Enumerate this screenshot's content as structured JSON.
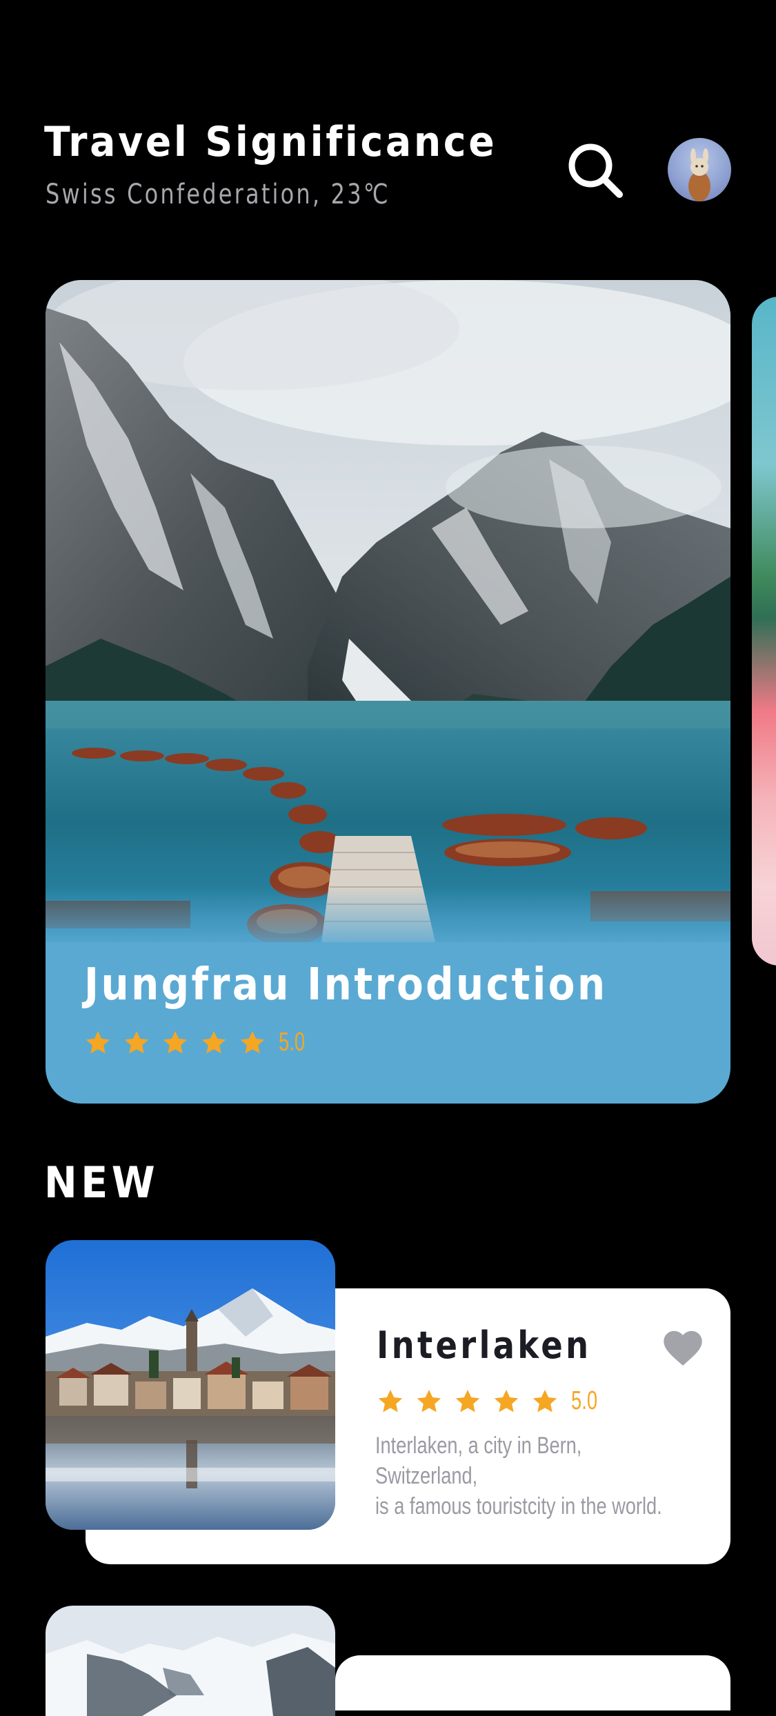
{
  "header": {
    "title": "Travel Significance",
    "subtitle": "Swiss Confederation, 23℃",
    "search_icon": "search-icon",
    "avatar": "user-avatar"
  },
  "featured": {
    "title": "Jungfrau Introduction",
    "rating": "5.0",
    "stars": 5,
    "accent": "#5aa9d3",
    "star_color": "#f5a623"
  },
  "new_section": {
    "title": "NEW",
    "items": [
      {
        "name": "Interlaken",
        "rating": "5.0",
        "stars": 5,
        "description_line1": "Interlaken, a city in Bern, Switzerland,",
        "description_line2": "is a famous touristcity in the world.",
        "favorite_icon": "heart-icon"
      }
    ]
  }
}
